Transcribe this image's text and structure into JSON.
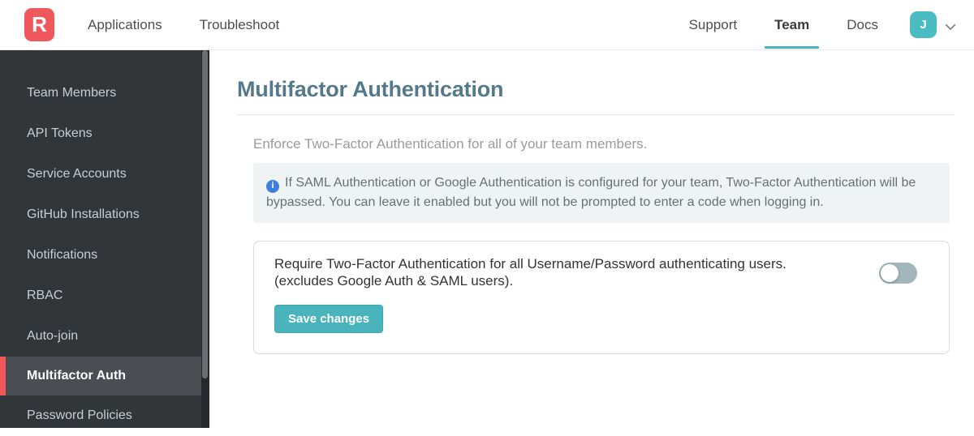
{
  "header": {
    "logo_letter": "R",
    "nav_left": [
      {
        "label": "Applications"
      },
      {
        "label": "Troubleshoot"
      }
    ],
    "nav_right": [
      {
        "label": "Support",
        "active": false
      },
      {
        "label": "Team",
        "active": true
      },
      {
        "label": "Docs",
        "active": false
      }
    ],
    "avatar_letter": "J"
  },
  "sidebar": {
    "items": [
      {
        "label": "Team Members",
        "active": false
      },
      {
        "label": "API Tokens",
        "active": false
      },
      {
        "label": "Service Accounts",
        "active": false
      },
      {
        "label": "GitHub Installations",
        "active": false
      },
      {
        "label": "Notifications",
        "active": false
      },
      {
        "label": "RBAC",
        "active": false
      },
      {
        "label": "Auto-join",
        "active": false
      },
      {
        "label": "Multifactor Auth",
        "active": true
      },
      {
        "label": "Password Policies",
        "active": false
      }
    ]
  },
  "main": {
    "title": "Multifactor Authentication",
    "description": "Enforce Two-Factor Authentication for all of your team members.",
    "info_note": "If SAML Authentication or Google Authentication is configured for your team, Two-Factor Authentication will be bypassed. You can leave it enabled but you will not be prompted to enter a code when logging in.",
    "card": {
      "requirement_line1": "Require Two-Factor Authentication for all Username/Password authenticating users.",
      "requirement_line2": "(excludes Google Auth & SAML users).",
      "save_label": "Save changes",
      "toggle_state": "off"
    }
  },
  "icons": {
    "info": "i"
  },
  "colors": {
    "brand_red": "#f1585c",
    "accent_teal": "#49b4bb",
    "heading_slate": "#54798a",
    "sidebar_bg": "#333639",
    "sidebar_active_bg": "#4a4d51",
    "info_banner_bg": "#eff3f4",
    "info_icon_blue": "#3d7edf",
    "toggle_off_gray": "#a3b6bc"
  }
}
